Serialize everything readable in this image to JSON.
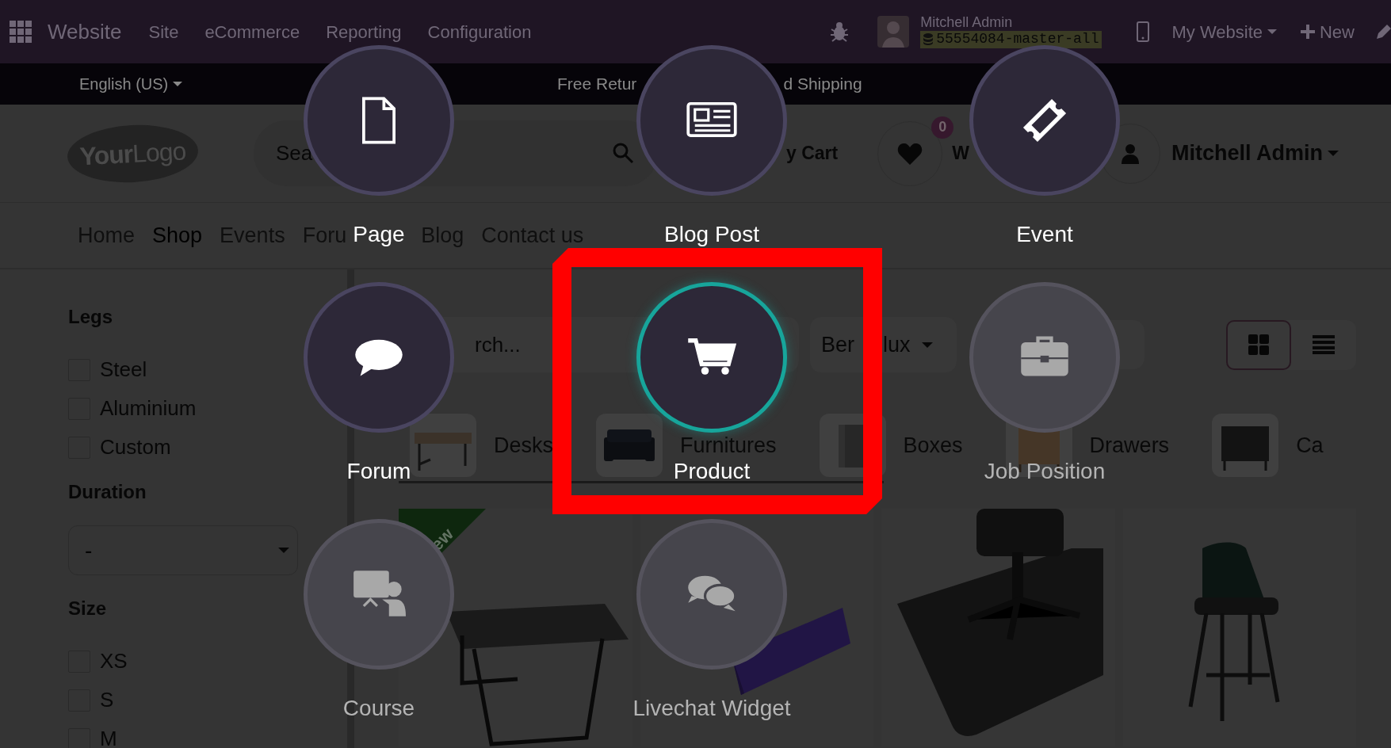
{
  "top_nav": {
    "app_title": "Website",
    "menus": [
      "Site",
      "eCommerce",
      "Reporting",
      "Configuration"
    ],
    "user_name": "Mitchell Admin",
    "database": "55554084-master-all",
    "website_switcher": "My Website",
    "new_button": "New"
  },
  "announcement_bar": {
    "language": "English (US)",
    "message_parts": [
      "Free Retur",
      "d Shipping"
    ]
  },
  "header": {
    "logo": "**Your**Logo",
    "search": {
      "placeholder": "Sea"
    },
    "cart_label": "y Cart",
    "wishlist_count": "0",
    "wishlist_label": "W",
    "account_name": "Mitchell Admin"
  },
  "site_menu": [
    {
      "label": "Home",
      "selected": false
    },
    {
      "label": "Shop",
      "selected": true
    },
    {
      "label": "Events",
      "selected": false
    },
    {
      "label": "Foru",
      "selected": false
    },
    {
      "label": "Blog",
      "selected": false
    },
    {
      "label": "Contact us",
      "selected": false
    }
  ],
  "filters": [
    {
      "title": "Legs",
      "kind": "checkboxes",
      "options": [
        {
          "label": "Steel",
          "checked": false
        },
        {
          "label": "Aluminium",
          "checked": false
        },
        {
          "label": "Custom",
          "checked": false
        }
      ]
    },
    {
      "title": "Duration",
      "kind": "select",
      "value": "-"
    },
    {
      "title": "Size",
      "kind": "checkboxes",
      "options": [
        {
          "label": "XS",
          "checked": false
        },
        {
          "label": "S",
          "checked": false
        },
        {
          "label": "M",
          "checked": false
        }
      ]
    }
  ],
  "products_toolbar": {
    "search": {
      "placeholder": "rch..."
    },
    "pricelist_parts": [
      "Ber",
      "lux"
    ],
    "view_modes": [
      {
        "kind": "grid",
        "selected": true
      },
      {
        "kind": "list",
        "selected": false
      }
    ]
  },
  "categories": [
    {
      "label": "Desks"
    },
    {
      "label": "Furnitures"
    },
    {
      "label": "Boxes"
    },
    {
      "label": "Drawers"
    },
    {
      "label": "Ca"
    }
  ],
  "products": [
    {
      "kind": "picture",
      "ribbon": "ew"
    },
    {
      "kind": "picture"
    },
    {
      "kind": "picture"
    },
    {
      "kind": "picture"
    }
  ],
  "new_content_dialog": {
    "options": [
      {
        "label": "Page",
        "selected": false,
        "disabled": false
      },
      {
        "label": "Blog Post",
        "selected": false,
        "disabled": false
      },
      {
        "label": "Event",
        "selected": false,
        "disabled": false
      },
      {
        "label": "Forum",
        "selected": false,
        "disabled": false
      },
      {
        "label": "Product",
        "selected": true,
        "disabled": false
      },
      {
        "label": "Job Position",
        "selected": false,
        "disabled": true
      },
      {
        "label": "Course",
        "selected": false,
        "disabled": true
      },
      {
        "label": "Livechat Widget",
        "selected": false,
        "disabled": true
      }
    ]
  }
}
